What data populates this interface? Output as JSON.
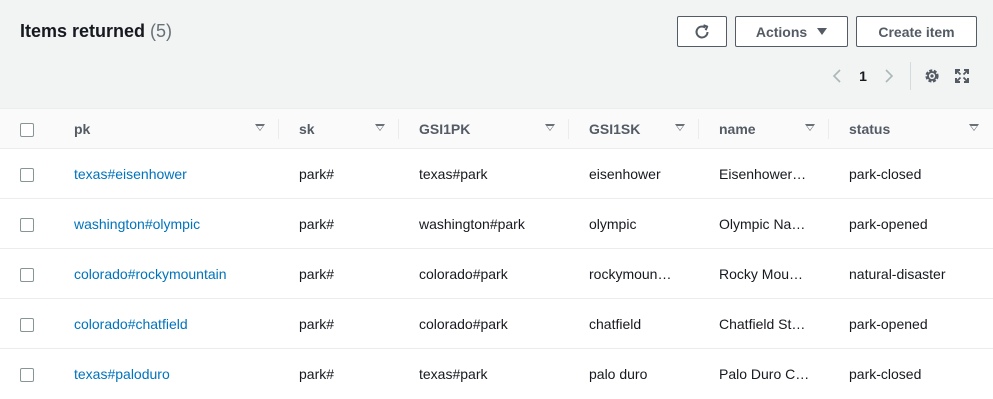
{
  "header": {
    "title": "Items returned",
    "count": "(5)",
    "actions_label": "Actions",
    "create_label": "Create item"
  },
  "pagination": {
    "current_page": "1"
  },
  "icons": {
    "refresh": "refresh-icon",
    "settings": "gear-icon",
    "expand": "expand-icon",
    "prev": "chevron-left-icon",
    "next": "chevron-right-icon"
  },
  "colors": {
    "link": "#0073bb",
    "header_bg": "#f2f3f3",
    "border": "#eaeded"
  },
  "table": {
    "columns": [
      "pk",
      "sk",
      "GSI1PK",
      "GSI1SK",
      "name",
      "status"
    ],
    "rows": [
      {
        "pk": "texas#eisenhower",
        "sk": "park#",
        "gsi1pk": "texas#park",
        "gsi1sk": "eisenhower",
        "name": "Eisenhower…",
        "status": "park-closed"
      },
      {
        "pk": "washington#olympic",
        "sk": "park#",
        "gsi1pk": "washington#park",
        "gsi1sk": "olympic",
        "name": "Olympic Na…",
        "status": "park-opened"
      },
      {
        "pk": "colorado#rockymountain",
        "sk": "park#",
        "gsi1pk": "colorado#park",
        "gsi1sk": "rockymoun…",
        "name": "Rocky Mou…",
        "status": "natural-disaster"
      },
      {
        "pk": "colorado#chatfield",
        "sk": "park#",
        "gsi1pk": "colorado#park",
        "gsi1sk": "chatfield",
        "name": "Chatfield St…",
        "status": "park-opened"
      },
      {
        "pk": "texas#paloduro",
        "sk": "park#",
        "gsi1pk": "texas#park",
        "gsi1sk": "palo duro",
        "name": "Palo Duro C…",
        "status": "park-closed"
      }
    ]
  }
}
